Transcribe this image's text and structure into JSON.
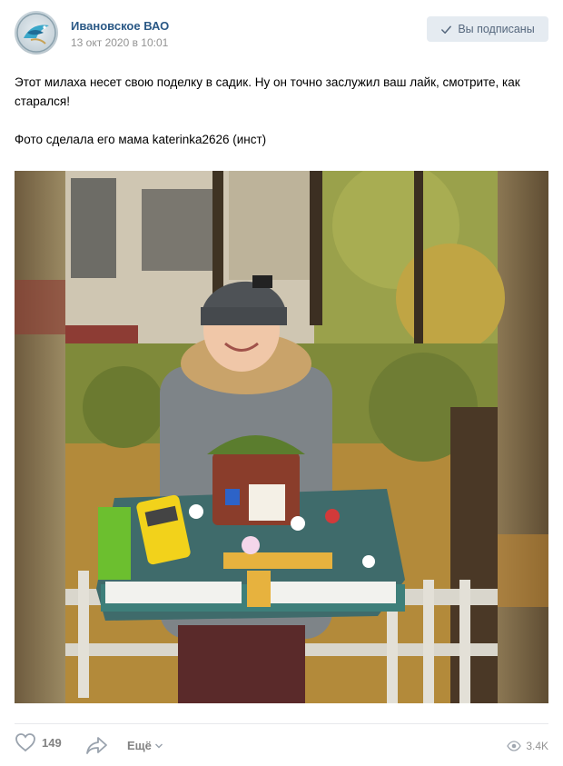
{
  "post": {
    "author": "Ивановское ВАО",
    "date": "13 окт 2020 в 10:01",
    "subscribe_label": "Вы подписаны",
    "text_lines": [
      "Этот милаха несет свою поделку в садик. Ну он точно заслужил ваш лайк, смотрите, как старался!",
      "Фото сделала его мама katerinka2626 (инст)"
    ],
    "photo_caption": "Photo: boy in grey hat and jacket holding a handmade garden diorama with a small house, yellow bus, fences and figurines, autumn leaves in background"
  },
  "footer": {
    "likes": "149",
    "more_label": "Ещё",
    "views": "3.4K"
  },
  "colors": {
    "link": "#2a5885",
    "muted": "#939393",
    "button_bg": "#e5ebf1",
    "button_text": "#55677d"
  },
  "icons": [
    "check-icon",
    "heart-icon",
    "share-icon",
    "chevron-down-icon",
    "eye-icon"
  ]
}
